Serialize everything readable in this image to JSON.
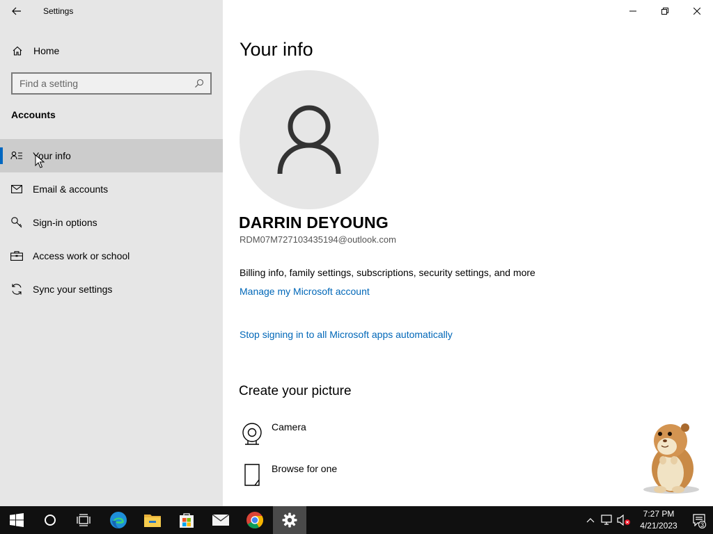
{
  "window": {
    "app_title": "Settings",
    "back_icon": "back-arrow-icon",
    "controls": [
      "minimize-icon",
      "restore-icon",
      "close-icon"
    ]
  },
  "sidebar": {
    "home_label": "Home",
    "search_placeholder": "Find a setting",
    "section_title": "Accounts",
    "items": [
      {
        "label": "Your info",
        "icon": "your-info-icon",
        "active": true
      },
      {
        "label": "Email & accounts",
        "icon": "mail-icon",
        "active": false
      },
      {
        "label": "Sign-in options",
        "icon": "key-icon",
        "active": false
      },
      {
        "label": "Access work or school",
        "icon": "briefcase-icon",
        "active": false
      },
      {
        "label": "Sync your settings",
        "icon": "sync-icon",
        "active": false
      }
    ]
  },
  "main": {
    "title": "Your info",
    "user_name": "DARRIN DEYOUNG",
    "user_email": "RDM07M727103435194@outlook.com",
    "billing_text": "Billing info, family settings, subscriptions, security settings, and more",
    "manage_link": "Manage my Microsoft account",
    "stop_link": "Stop signing in to all Microsoft apps automatically",
    "picture_title": "Create your picture",
    "picture_options": [
      {
        "label": "Camera",
        "icon": "camera-icon"
      },
      {
        "label": "Browse for one",
        "icon": "browse-file-icon"
      }
    ]
  },
  "taskbar": {
    "apps": [
      "start-icon",
      "cortana-icon",
      "task-view-icon",
      "edge-icon",
      "file-explorer-icon",
      "store-icon",
      "mail-app-icon",
      "chrome-icon",
      "settings-icon"
    ],
    "time": "7:27 PM",
    "date": "4/21/2023",
    "notification_count": "3"
  },
  "colors": {
    "accent": "#0067c0",
    "link": "#0067b8",
    "sidebar_bg": "#e6e6e6",
    "taskbar_bg": "#101010"
  }
}
